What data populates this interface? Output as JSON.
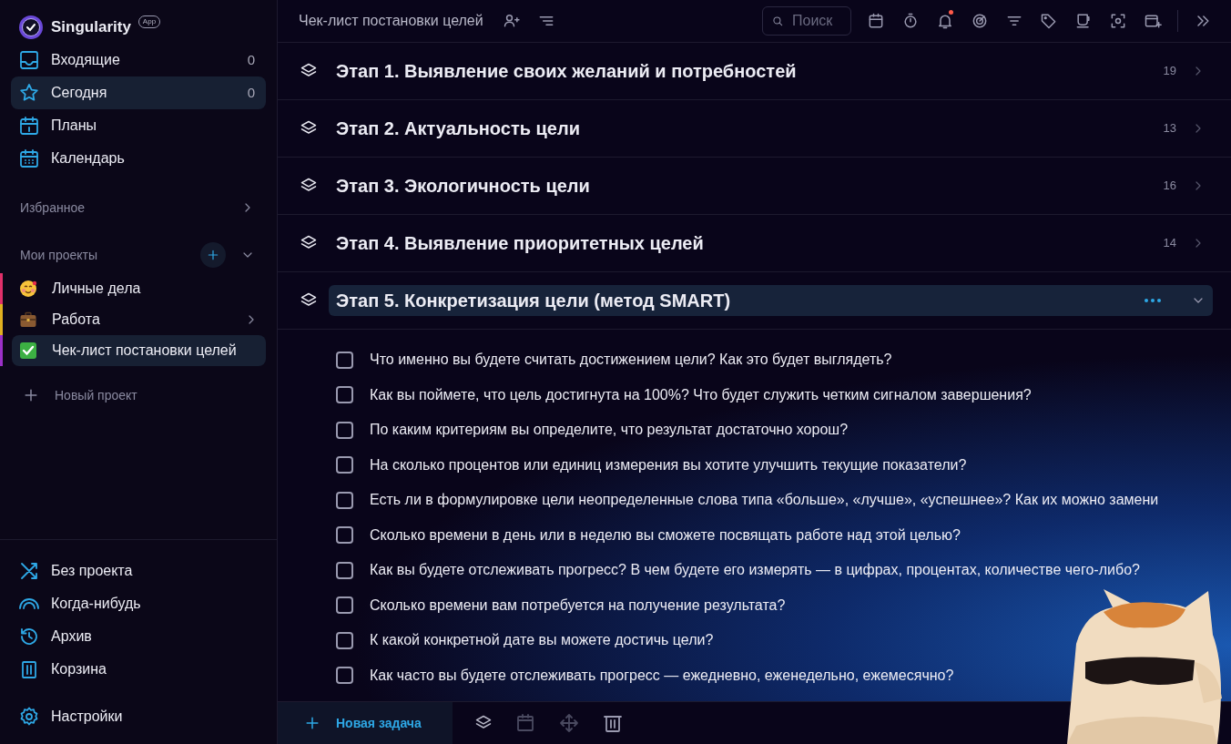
{
  "app": {
    "name": "Singularity",
    "badge": "App"
  },
  "nav": [
    {
      "kind": "inbox",
      "label": "Входящие",
      "count": "0",
      "selected": false
    },
    {
      "kind": "star",
      "label": "Сегодня",
      "count": "0",
      "selected": true
    },
    {
      "kind": "plans",
      "label": "Планы",
      "selected": false
    },
    {
      "kind": "calendar",
      "label": "Календарь",
      "selected": false
    }
  ],
  "favorites": {
    "label": "Избранное"
  },
  "projects": {
    "label": "Мои проекты",
    "items": [
      {
        "kind": "personal",
        "label": "Личные дела",
        "color": "#e0306a",
        "has_children": false,
        "selected": false
      },
      {
        "kind": "work",
        "label": "Работа",
        "color": "#e0b020",
        "has_children": true,
        "selected": false
      },
      {
        "kind": "checklist",
        "label": "Чек-лист постановки целей",
        "color": "#9b30c8",
        "has_children": false,
        "selected": true
      }
    ],
    "new_project": "Новый проект"
  },
  "bottom_nav": [
    {
      "kind": "shuffle",
      "label": "Без проекта"
    },
    {
      "kind": "rainbow",
      "label": "Когда-нибудь"
    },
    {
      "kind": "history",
      "label": "Архив"
    },
    {
      "kind": "trash",
      "label": "Корзина"
    }
  ],
  "settings": {
    "label": "Настройки"
  },
  "header": {
    "title": "Чек-лист постановки целей",
    "search_placeholder": "Поиск",
    "notification_dot": true
  },
  "stages": [
    {
      "title": "Этап 1. Выявление своих желаний и потребностей",
      "count": "19",
      "expanded": false
    },
    {
      "title": "Этап 2. Актуальность цели",
      "count": "13",
      "expanded": false
    },
    {
      "title": "Этап 3. Экологичность цели",
      "count": "16",
      "expanded": false
    },
    {
      "title": "Этап 4. Выявление приоритетных целей",
      "count": "14",
      "expanded": false
    },
    {
      "title": "Этап 5. Конкретизация цели (метод SMART)",
      "expanded": true
    }
  ],
  "tasks": [
    {
      "text": "Что именно вы будете считать достижением цели? Как это будет выглядеть?",
      "checked": false
    },
    {
      "text": "Как вы поймете, что цель достигнута на 100%? Что будет служить четким сигналом завершения?",
      "checked": false
    },
    {
      "text": "По каким критериям вы определите, что результат достаточно хорош?",
      "checked": false
    },
    {
      "text": "На сколько процентов или единиц измерения вы хотите улучшить текущие показатели?",
      "checked": false
    },
    {
      "text": "Есть ли в формулировке цели неопределенные слова типа «больше», «лучше», «успешнее»? Как их можно замени",
      "checked": false
    },
    {
      "text": "Сколько времени в день или в неделю вы сможете посвящать работе над этой целью?",
      "checked": false
    },
    {
      "text": "Как вы будете отслеживать прогресс? В чем будете его измерять — в цифрах, процентах, количестве чего-либо?",
      "checked": false
    },
    {
      "text": "Сколько времени вам потребуется на получение результата?",
      "checked": false
    },
    {
      "text": "К какой конкретной дате вы можете достичь цели?",
      "checked": false
    },
    {
      "text": "Как часто вы будете отслеживать прогресс — ежедневно, еженедельно, ежемесячно?",
      "checked": false
    }
  ],
  "footer": {
    "new_task": "Новая задача"
  }
}
